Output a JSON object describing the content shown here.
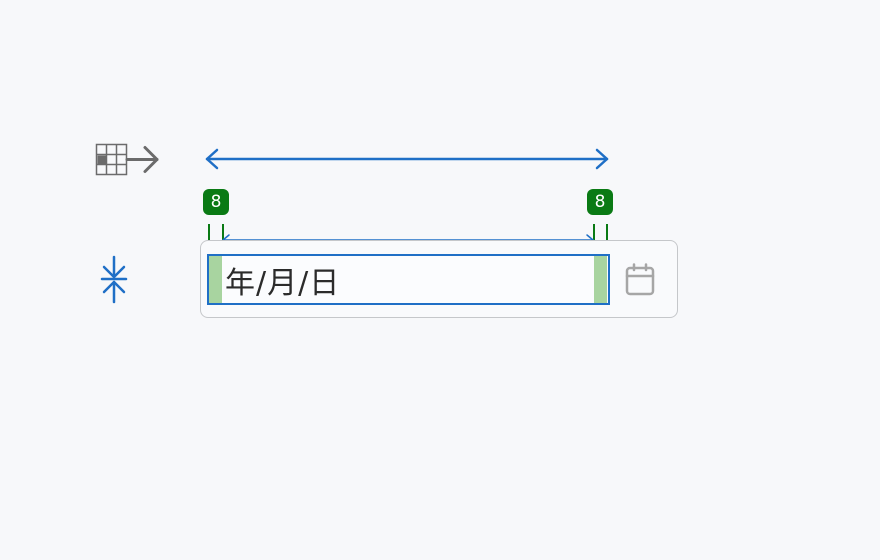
{
  "indicators": {
    "left_padding": "8",
    "right_padding": "8"
  },
  "date_input": {
    "placeholder": "年/月/日"
  },
  "icons": {
    "grid_arrow": "table-arrow-right-icon",
    "vertical_fit": "vertical-collapse-icon",
    "calendar": "calendar-icon"
  },
  "colors": {
    "measure_blue": "#1f6fc6",
    "padding_green": "#0a7a14",
    "padding_fill": "#a8d4a0"
  }
}
